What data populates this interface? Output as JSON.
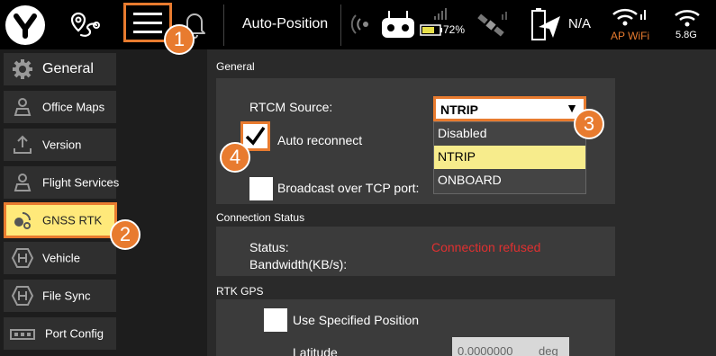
{
  "toolbar": {
    "auto_position_label": "Auto-Position",
    "battery_percent": "72%",
    "gps_status": "N/A",
    "ap_wifi_label": "AP WiFi",
    "wifi_band": "5.8G",
    "accent_color": "#e87b2f"
  },
  "callouts": [
    "1",
    "2",
    "3",
    "4"
  ],
  "sidebar": {
    "items": [
      {
        "label": "General",
        "icon": "gear-icon"
      },
      {
        "label": "Office Maps",
        "icon": "person-map-icon"
      },
      {
        "label": "Version",
        "icon": "version-upload-icon"
      },
      {
        "label": "Flight Services",
        "icon": "person-map-icon"
      },
      {
        "label": "GNSS RTK",
        "icon": "satellite-icon"
      },
      {
        "label": "Vehicle",
        "icon": "vehicle-h-icon"
      },
      {
        "label": "File Sync",
        "icon": "file-sync-h-icon"
      },
      {
        "label": "Port Config",
        "icon": "port-config-icon"
      }
    ],
    "active_item": "GNSS RTK",
    "active_color": "#ffe97a"
  },
  "general": {
    "header": "General",
    "rtcm_source_label": "RTCM Source:",
    "rtcm_source_value": "NTRIP",
    "dropdown_options": [
      "Disabled",
      "NTRIP",
      "ONBOARD"
    ],
    "highlighted_option": "NTRIP",
    "auto_reconnect_label": "Auto reconnect",
    "auto_reconnect_checked": true,
    "broadcast_label": "Broadcast over TCP port:",
    "broadcast_checked": false
  },
  "connection": {
    "header": "Connection Status",
    "status_label": "Status:",
    "status_value": "Connection refused",
    "bandwidth_label": "Bandwidth(KB/s):",
    "error_color": "#e03030"
  },
  "rtk_gps": {
    "header": "RTK GPS",
    "use_specified_label": "Use Specified Position",
    "latitude_label": "Latitude",
    "latitude_value": "0.0000000",
    "latitude_unit": "deg"
  }
}
